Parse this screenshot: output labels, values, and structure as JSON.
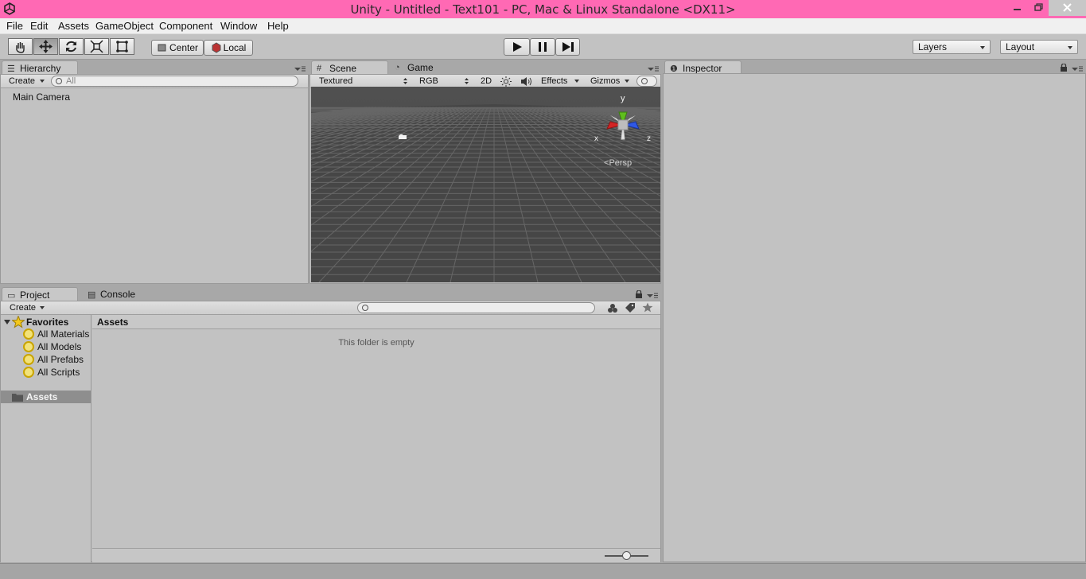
{
  "window": {
    "title": "Unity - Untitled - Text101 - PC, Mac & Linux Standalone <DX11>",
    "controls": [
      "minimize",
      "restore",
      "close"
    ]
  },
  "menu": [
    "File",
    "Edit",
    "Assets",
    "GameObject",
    "Component",
    "Window",
    "Help"
  ],
  "toolbar": {
    "tools": [
      "hand-icon",
      "move-icon",
      "rotate-icon",
      "scale-icon",
      "rect-icon"
    ],
    "active_tool": "move-icon",
    "pivot_center": "Center",
    "pivot_local": "Local",
    "layers": "Layers",
    "layout": "Layout"
  },
  "hierarchy": {
    "tab": "Hierarchy",
    "create": "Create",
    "search_placeholder": "All",
    "items": [
      "Main Camera"
    ]
  },
  "scene": {
    "tab_scene": "Scene",
    "tab_game": "Game",
    "draw_mode": "Textured",
    "render_mode": "RGB",
    "mode_2d": "2D",
    "effects": "Effects",
    "gizmos": "Gizmos",
    "gizmo_labels": {
      "y": "y",
      "x": "x",
      "z": "z"
    },
    "projection": "Persp"
  },
  "inspector": {
    "tab": "Inspector"
  },
  "project": {
    "tab_project": "Project",
    "tab_console": "Console",
    "create": "Create",
    "favorites": {
      "header": "Favorites",
      "items": [
        "All Materials",
        "All Models",
        "All Prefabs",
        "All Scripts"
      ]
    },
    "assets_folder": "Assets",
    "breadcrumb": "Assets",
    "empty_message": "This folder is empty",
    "zoom": 0.5
  },
  "colors": {
    "titlebar": "#ff69b4",
    "panel": "#c2c2c2",
    "scene_bg": "#444444",
    "gizmo_x": "#d42424",
    "gizmo_y": "#5fbe1d",
    "gizmo_z": "#2f58e6"
  }
}
